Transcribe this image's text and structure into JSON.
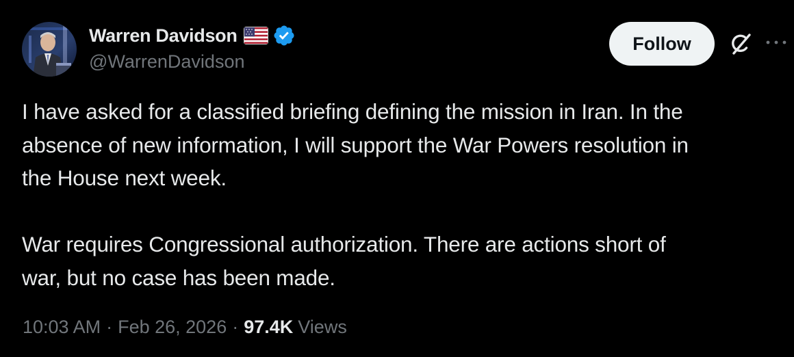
{
  "author": {
    "display_name": "Warren Davidson",
    "handle": "@WarrenDavidson",
    "badges": [
      "us-flag-icon",
      "verified-icon"
    ]
  },
  "actions": {
    "follow_label": "Follow",
    "grok_icon": "grok-icon",
    "more_icon": "more-options-icon"
  },
  "tweet": {
    "text": "I have asked for a classified briefing defining the mission in Iran. In the\nabsence of new information, I will support the War Powers resolution in\nthe House next week.\n\nWar requires Congressional authorization. There are actions short of\nwar, but no case has been made."
  },
  "meta": {
    "time": "10:03 AM",
    "separator": "·",
    "date": "Feb 26, 2026",
    "views_count": "97.4K",
    "views_label": "Views"
  },
  "colors": {
    "background": "#000000",
    "primary_text": "#e7e9ea",
    "secondary_text": "#71767b",
    "follow_button_bg": "#eff3f4",
    "follow_button_text": "#0f1419",
    "verified_blue": "#1d9bf0"
  }
}
